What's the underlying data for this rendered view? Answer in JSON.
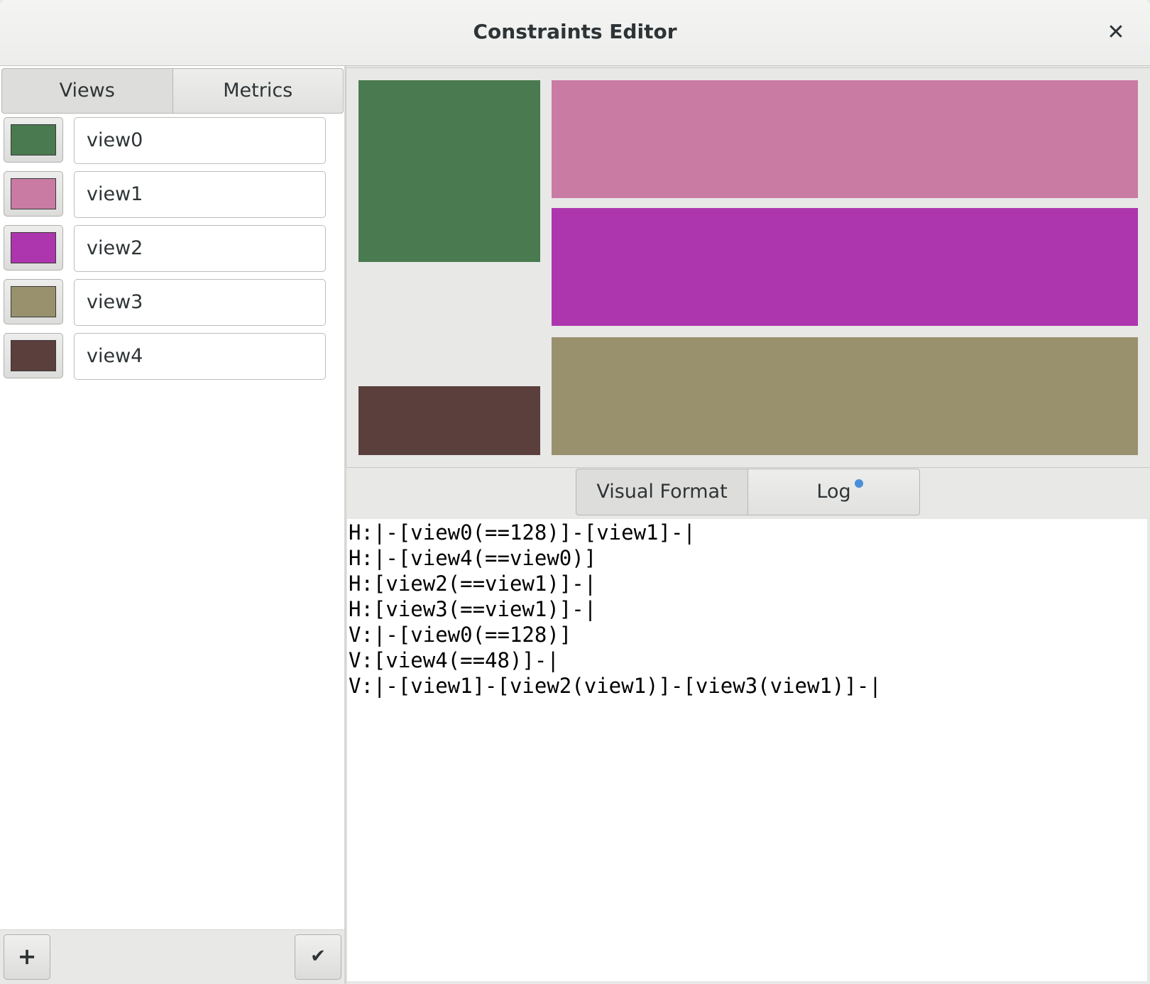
{
  "window": {
    "title": "Constraints Editor",
    "close_glyph": "✕"
  },
  "sidebar": {
    "tabs": [
      {
        "label": "Views",
        "active": true
      },
      {
        "label": "Metrics",
        "active": false
      }
    ],
    "views": [
      {
        "name": "view0",
        "color": "#4a7a50"
      },
      {
        "name": "view1",
        "color": "#c97ba3"
      },
      {
        "name": "view2",
        "color": "#ad36ae"
      },
      {
        "name": "view3",
        "color": "#99916d"
      },
      {
        "name": "view4",
        "color": "#5b3f3c"
      }
    ],
    "footer": {
      "add_glyph": "+",
      "apply_glyph": "✔"
    }
  },
  "bottom_tabs": [
    {
      "label": "Visual Format",
      "active": true
    },
    {
      "label": "Log",
      "active": false,
      "needs_attention": true
    }
  ],
  "visual_format_lines": [
    "H:|-[view0(==128)]-[view1]-|",
    "H:|-[view4(==view0)]",
    "H:[view2(==view1)]-|",
    "H:[view3(==view1)]-|",
    "V:|-[view0(==128)]",
    "V:[view4(==48)]-|",
    "V:|-[view1]-[view2(view1)]-[view3(view1)]-|"
  ],
  "colors": {
    "attention_dot": "#4a90d9"
  }
}
